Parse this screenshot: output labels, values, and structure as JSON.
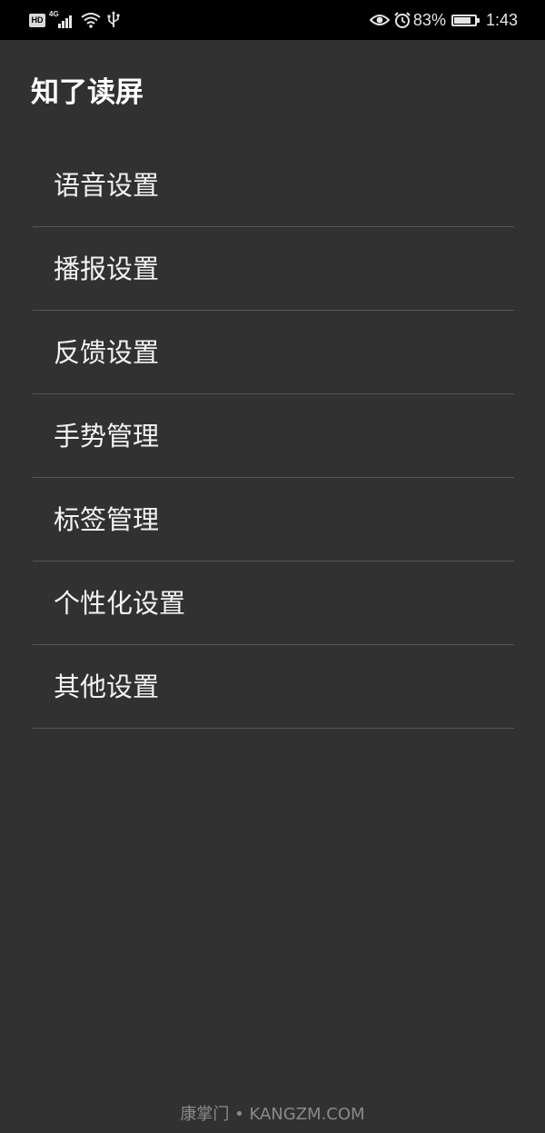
{
  "status_bar": {
    "hd_badge": "HD",
    "network": "4G",
    "battery_percent": "83%",
    "battery_level": 0.83,
    "time": "1:43",
    "icons": [
      "hd-icon",
      "signal-icon",
      "wifi-icon",
      "usb-icon",
      "eye-icon",
      "alarm-icon",
      "battery-icon"
    ]
  },
  "app": {
    "title": "知了读屏"
  },
  "menu": {
    "items": [
      {
        "label": "语音设置"
      },
      {
        "label": "播报设置"
      },
      {
        "label": "反馈设置"
      },
      {
        "label": "手势管理"
      },
      {
        "label": "标签管理"
      },
      {
        "label": "个性化设置"
      },
      {
        "label": "其他设置"
      }
    ]
  },
  "watermark": {
    "text": "康掌门 • KANGZM.COM"
  },
  "colors": {
    "background": "#313131",
    "status_bar": "#000000",
    "divider": "#555555",
    "text": "#ffffff"
  }
}
